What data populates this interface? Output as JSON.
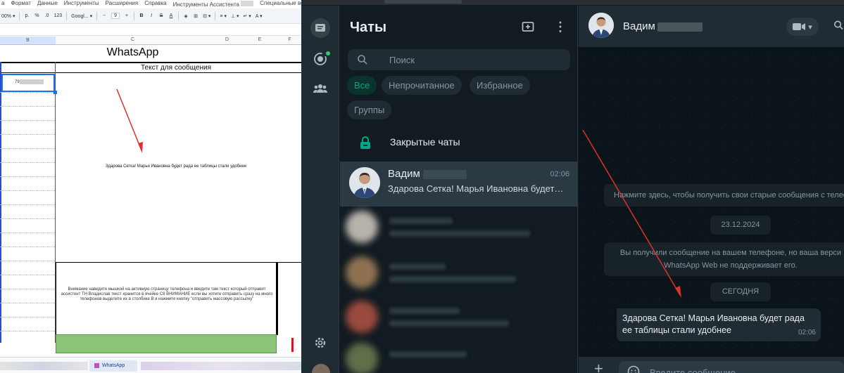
{
  "sheet": {
    "menu": [
      "а",
      "Формат",
      "Данные",
      "Инструменты",
      "Расширения",
      "Справка",
      "Инструменты Ассистента",
      "Специальные возможн"
    ],
    "toolbar": {
      "zoom": "00%",
      "format_pct": "%",
      "format_dec": ".0",
      "format_123": "123",
      "font": "Googl...",
      "font_size": "9",
      "bold": "B",
      "italic": "I",
      "strike": "S",
      "text_color": "A"
    },
    "columns": [
      "B",
      "C",
      "D",
      "E",
      "F"
    ],
    "title": "WhatsApp",
    "column_header": "Текст для сообщения",
    "phone_cell_prefix": "79",
    "message_cell": "Здарова Сетка! Марья Ивановна будет рада ее таблицы стали удобнее",
    "notice_text": "Внимание наведите мышкой на активную страницу телефона и введите там текст который отправит ассистент ТН Владислав текст хранится в ячейке C8 ВНИМАНИЕ если вы хотите отправить сразу на много телефонов выделите их в столбике B и нажмите кнопку \"отправить массовую рассылку\"",
    "sheet_tab": "WhatsApp"
  },
  "whatsapp": {
    "list_title": "Чаты",
    "search_placeholder": "Поиск",
    "filters": [
      "Все",
      "Непрочитанное",
      "Избранное",
      "Группы"
    ],
    "archived_label": "Закрытые чаты",
    "active_chat": {
      "name": "Вадим",
      "time": "02:06",
      "preview": "Здарова Сетка! Марья Ивановна будет ра..."
    },
    "header_name": "Вадим",
    "system_old_messages": "Нажмите здесь, чтобы получить свои старые сообщения с телефо",
    "date_label": "23.12.2024",
    "system_unsupported_line1": "Вы получили сообщение на вашем телефоне, но ваша верси",
    "system_unsupported_line2": "WhatsApp Web не поддерживает его.",
    "today_label": "СЕГОДНЯ",
    "message": {
      "text": "Здарова Сетка! Марья Ивановна будет рада ее таблицы стали удобнее",
      "time": "02:06"
    },
    "composer_placeholder": "Введите сообщение"
  },
  "colors": {
    "wa_panel": "#111b21",
    "wa_header": "#202c33",
    "wa_accent": "#00a884",
    "arrow": "#e0302a",
    "sheet_green": "#8cc477"
  },
  "icons": [
    "new-chat-icon",
    "menu-dots-icon",
    "search-icon",
    "lock-icon",
    "chats-icon",
    "status-icon",
    "communities-icon",
    "settings-icon",
    "video-call-icon",
    "emoji-icon",
    "plus-icon"
  ]
}
